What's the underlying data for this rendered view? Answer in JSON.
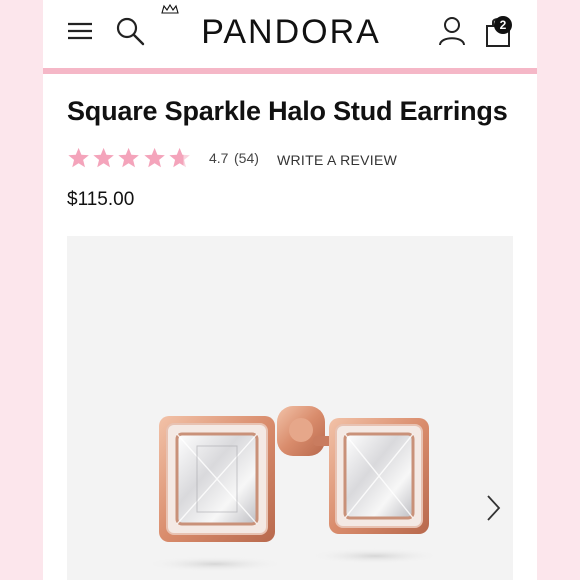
{
  "header": {
    "logo_text": "PANDORA",
    "bag_count": "2",
    "accent_color": "#f5b7c7"
  },
  "product": {
    "title": "Square Sparkle Halo Stud Earrings",
    "rating": {
      "value": "4.7",
      "count": "(54)",
      "stars_filled": 4.7,
      "stars_total": 5,
      "star_color": "#f4a4bb"
    },
    "write_review_label": "WRITE A REVIEW",
    "price": "$115.00"
  },
  "icons": {
    "menu": "hamburger-menu-icon",
    "search": "search-icon",
    "account": "user-icon",
    "bag": "shopping-bag-icon",
    "next": "chevron-right-icon"
  }
}
